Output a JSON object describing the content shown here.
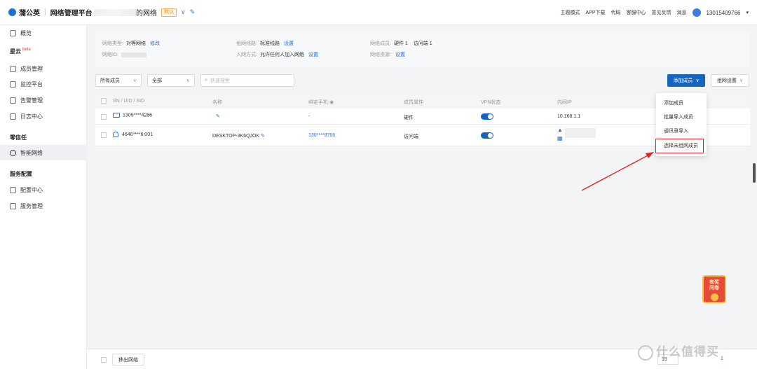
{
  "app": {
    "brand": "蒲公英",
    "subtitle": "网络管理平台"
  },
  "header": {
    "network_name_suffix": "的网络",
    "default_badge": "默认",
    "links": [
      "主题模式",
      "APP下载",
      "代码",
      "客服中心",
      "意见反馈",
      "消息"
    ],
    "user_phone": "13015409766"
  },
  "sidebar": {
    "overview": "概览",
    "section_xingyun": "星云",
    "beta": "beta",
    "xingyun_items": [
      "成员管理",
      "监控平台",
      "告警管理",
      "日志中心"
    ],
    "section_zerotrust": "零信任",
    "zerotrust_items": [
      "智能网络"
    ],
    "section_service": "服务配置",
    "service_items": [
      "配置中心",
      "服务管理"
    ]
  },
  "info": {
    "net_type_label": "网络类型:",
    "net_type_value": "对等网络",
    "net_type_link": "修改",
    "net_id_label": "网络ID:",
    "line_label": "组网线路:",
    "line_value": "标准线路",
    "line_link": "设置",
    "join_label": "入网方式:",
    "join_value": "允许任何人加入网络",
    "join_link": "设置",
    "members_label": "网络成员:",
    "members_hw": "硬件 1",
    "members_visitor": "访问端 1",
    "resources_label": "网络资源:",
    "resources_link": "设置"
  },
  "filters": {
    "member_select": "所有成员",
    "scope_select": "全部",
    "search_placeholder": "快速搜索",
    "add_member_button": "添加成员",
    "network_settings_button": "组网设置"
  },
  "table": {
    "columns": [
      "SN / UID / SID",
      "名称",
      "绑定手机",
      "成员属性",
      "VPN状态",
      "内网IP"
    ],
    "rows": [
      {
        "id": "1305****4286",
        "name": "",
        "phone": "-",
        "attr": "硬件",
        "vpn": true,
        "ip": "10.168.1.1"
      },
      {
        "id": "4646****6:001",
        "name": "DESKTOP-3K6QJOK",
        "phone": "130****9766",
        "attr": "访问端",
        "vpn": true,
        "ip": ""
      }
    ]
  },
  "dropdown": {
    "items": [
      "添加成员",
      "批量导入成员",
      "通讯录导入",
      "选择未组网成员"
    ],
    "highlighted_index": 3
  },
  "footer": {
    "exit_button": "移出网络",
    "page_size": "15",
    "page_number": "1"
  },
  "promo": {
    "line1": "有奖",
    "line2": "问卷"
  },
  "watermark": "什么值得买",
  "colors": {
    "primary": "#1565c0",
    "link": "#2a6fd6",
    "highlight": "#e02424"
  }
}
